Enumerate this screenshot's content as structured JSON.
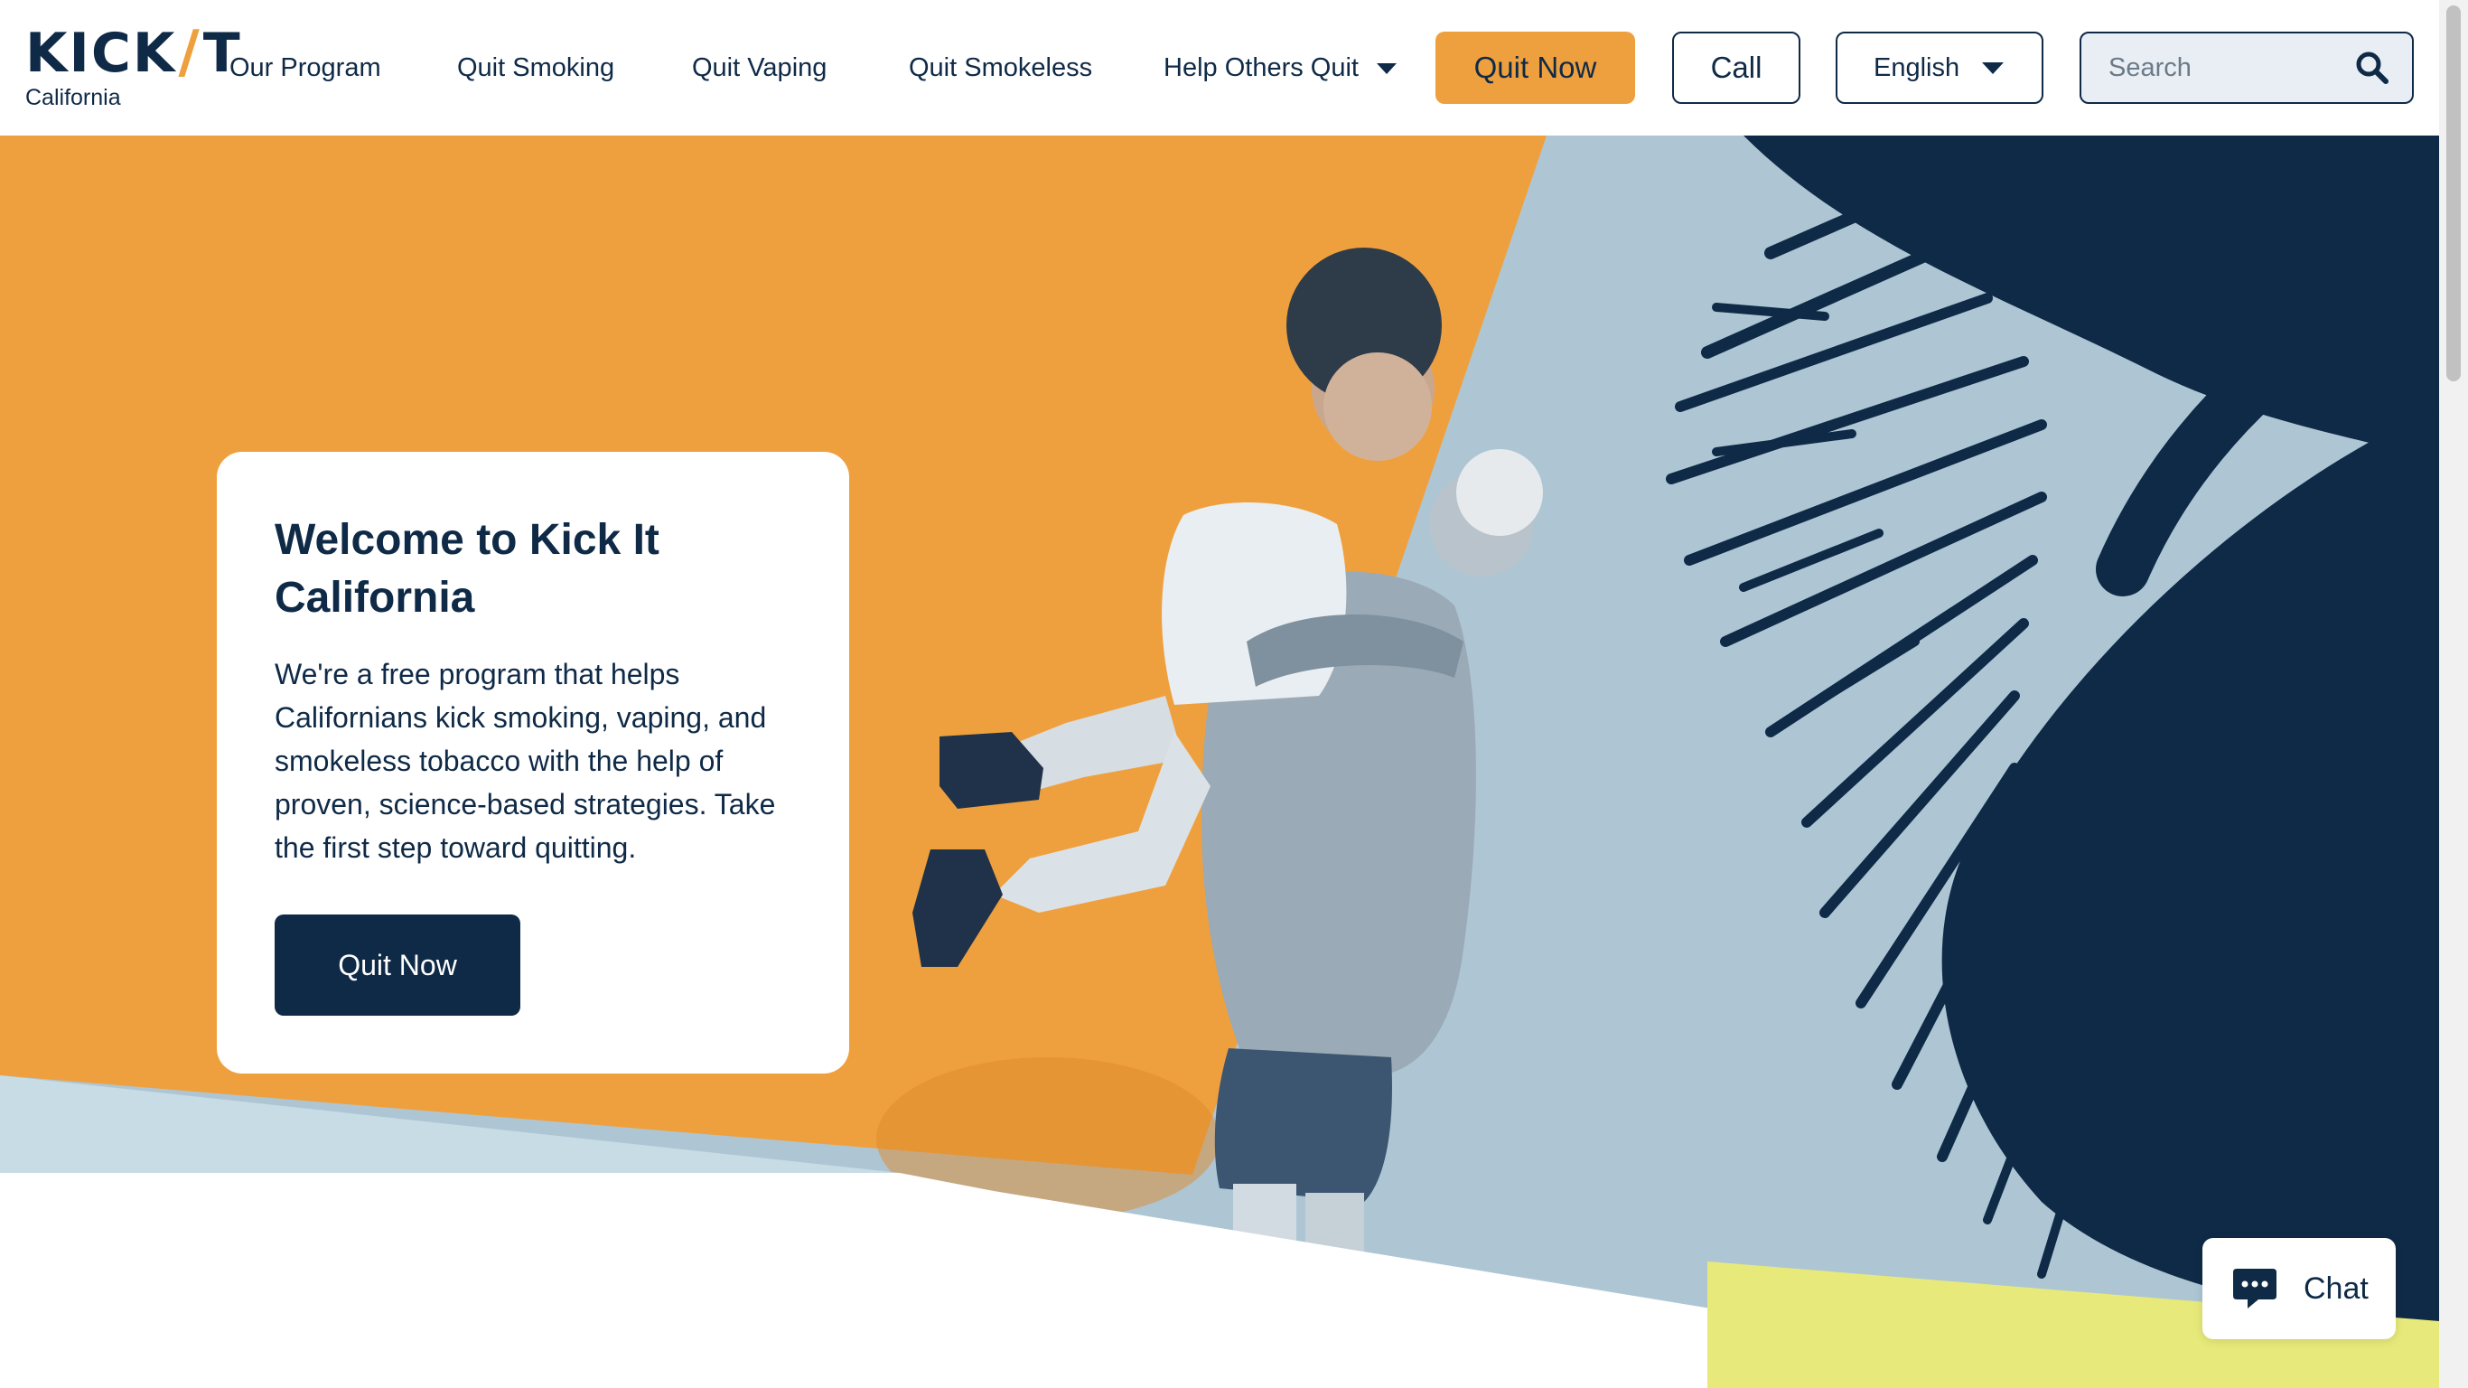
{
  "logo": {
    "brand_left": "KICK",
    "brand_slash": "/",
    "brand_right": "T",
    "region": "California"
  },
  "nav": {
    "items": [
      {
        "label": "Our Program"
      },
      {
        "label": "Quit Smoking"
      },
      {
        "label": "Quit Vaping"
      },
      {
        "label": "Quit Smokeless"
      },
      {
        "label": "Help Others Quit"
      }
    ]
  },
  "header_actions": {
    "quit_now_label": "Quit Now",
    "call_label": "Call",
    "language": "English",
    "search_placeholder": "Search"
  },
  "hero": {
    "title": "Welcome to Kick It California",
    "body": "We're a free program that helps Californians kick smoking, vaping, and smokeless tobacco with the help of proven, science-based strategies. Take the first step toward quitting.",
    "cta_label": "Quit Now"
  },
  "chat": {
    "label": "Chat"
  },
  "colors": {
    "navy": "#0f2a47",
    "orange": "#efa03e",
    "light_blue": "#aec6d4",
    "yellow": "#e7ea7a"
  },
  "icons": {
    "search": "search-icon",
    "chat": "chat-bubble-icon",
    "dropdown": "chevron-down-icon"
  }
}
